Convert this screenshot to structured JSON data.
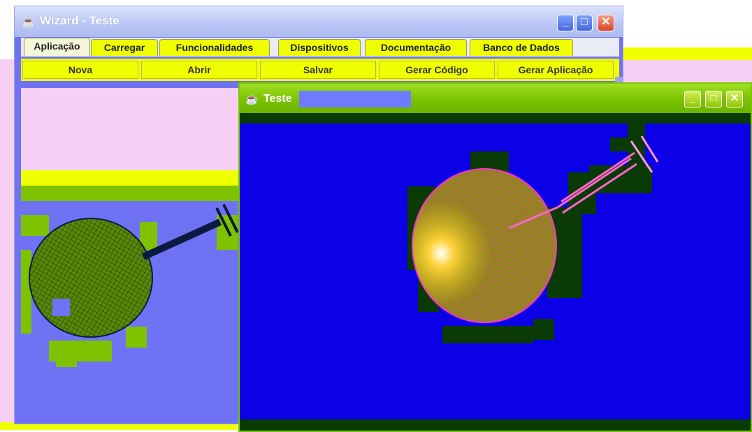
{
  "wizard_window": {
    "title": "Wizard - Teste",
    "controls": [
      "_",
      "□",
      "✕"
    ],
    "tabs": [
      {
        "label": "Aplicação"
      },
      {
        "label": "Carregar"
      },
      {
        "label": "Funcionalidades"
      },
      {
        "label": "Dispositivos"
      },
      {
        "label": "Documentação"
      },
      {
        "label": "Banco de Dados"
      }
    ],
    "toolbar_buttons": [
      {
        "label": "Nova"
      },
      {
        "label": "Abrir"
      },
      {
        "label": "Salvar"
      },
      {
        "label": "Gerar Código"
      },
      {
        "label": "Gerar Aplicação"
      }
    ]
  },
  "teste_window": {
    "title": "Teste",
    "controls": [
      "_",
      "□",
      "✕"
    ]
  },
  "colors": {
    "yellow": "#f0ff00",
    "pink": "#f6d0f4",
    "wizard_blue": "#6f72f2",
    "viewport_blue": "#0b00e6",
    "teste_green": "#78c800",
    "dark_green": "#0a3a06"
  },
  "icons": {
    "app_icon": "java-coffee-cup-icon",
    "minimize": "minimize-icon",
    "maximize": "maximize-icon",
    "close": "close-icon"
  }
}
